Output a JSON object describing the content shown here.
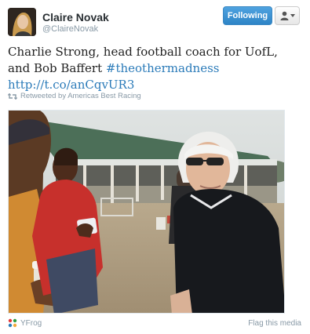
{
  "header": {
    "display_name": "Claire Novak",
    "handle": "@ClaireNovak"
  },
  "actions": {
    "follow_label": "Following"
  },
  "tweet": {
    "text_line": "Charlie Strong, head football coach for UofL, and Bob Baffert ",
    "hashtag": "#theothermadness",
    "link": "http://t.co/anCqvUR3",
    "retweet_text": "Retweeted by Americas Best Racing"
  },
  "footer": {
    "source": "YFrog",
    "flag_label": "Flag this media"
  },
  "colors": {
    "follow_button": "#2e84c6",
    "link": "#2b7bb9",
    "meta_text": "#8899a6"
  }
}
